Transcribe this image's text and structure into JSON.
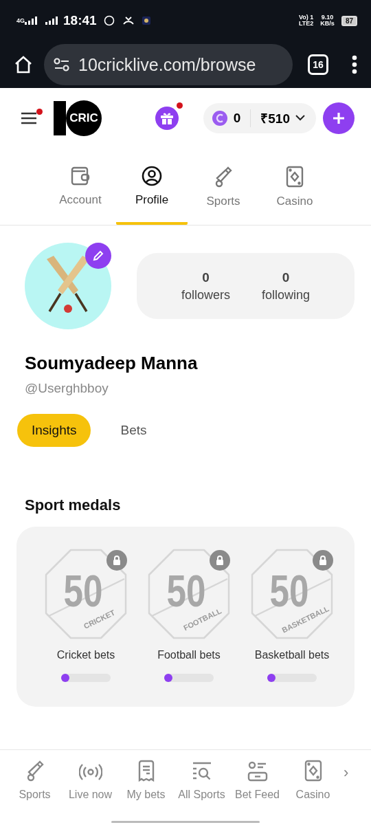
{
  "status_bar": {
    "network": "4G",
    "time": "18:41",
    "volte": "Vo) 1",
    "lte": "LTE2",
    "speed": "9.10",
    "speed_unit": "KB/s",
    "battery": "87"
  },
  "browser": {
    "url": "10cricklive.com/browse",
    "tab_count": "16"
  },
  "header": {
    "logo_text": "CRIC",
    "menu_badge": true,
    "gift_badge": true,
    "coins": "0",
    "balance": "₹510"
  },
  "account_tabs": [
    {
      "label": "Account",
      "kind": "wallet",
      "selected": false
    },
    {
      "label": "Profile",
      "kind": "person",
      "selected": true
    },
    {
      "label": "Sports",
      "kind": "bat",
      "selected": false
    },
    {
      "label": "Casino",
      "kind": "card",
      "selected": false
    }
  ],
  "profile": {
    "name": "Soumyadeep Manna",
    "handle": "@Userghbboy",
    "stats": [
      {
        "value": "0",
        "label": "followers"
      },
      {
        "value": "0",
        "label": "following"
      }
    ]
  },
  "profile_tabs": [
    {
      "label": "Insights",
      "selected": true
    },
    {
      "label": "Bets",
      "selected": false
    }
  ],
  "sport_medals": {
    "title": "Sport medals",
    "items": [
      {
        "badge_number": "50",
        "badge_text": "CRICKET",
        "label": "Cricket bets",
        "locked": true,
        "level": 0.05
      },
      {
        "badge_number": "50",
        "badge_text": "FOOTBALL",
        "label": "Football bets",
        "locked": true,
        "level": 0.05
      },
      {
        "badge_number": "50",
        "badge_text": "BASKETBALL",
        "label": "Basketball bets",
        "locked": true,
        "level": 0.05
      }
    ]
  },
  "bottom_nav": {
    "items": [
      {
        "label": "Sports",
        "kind": "bat"
      },
      {
        "label": "Live now",
        "kind": "live"
      },
      {
        "label": "My bets",
        "kind": "receipt"
      },
      {
        "label": "All Sports",
        "kind": "search"
      },
      {
        "label": "Bet Feed",
        "kind": "feed"
      },
      {
        "label": "Casino",
        "kind": "card"
      }
    ],
    "more": "›"
  }
}
